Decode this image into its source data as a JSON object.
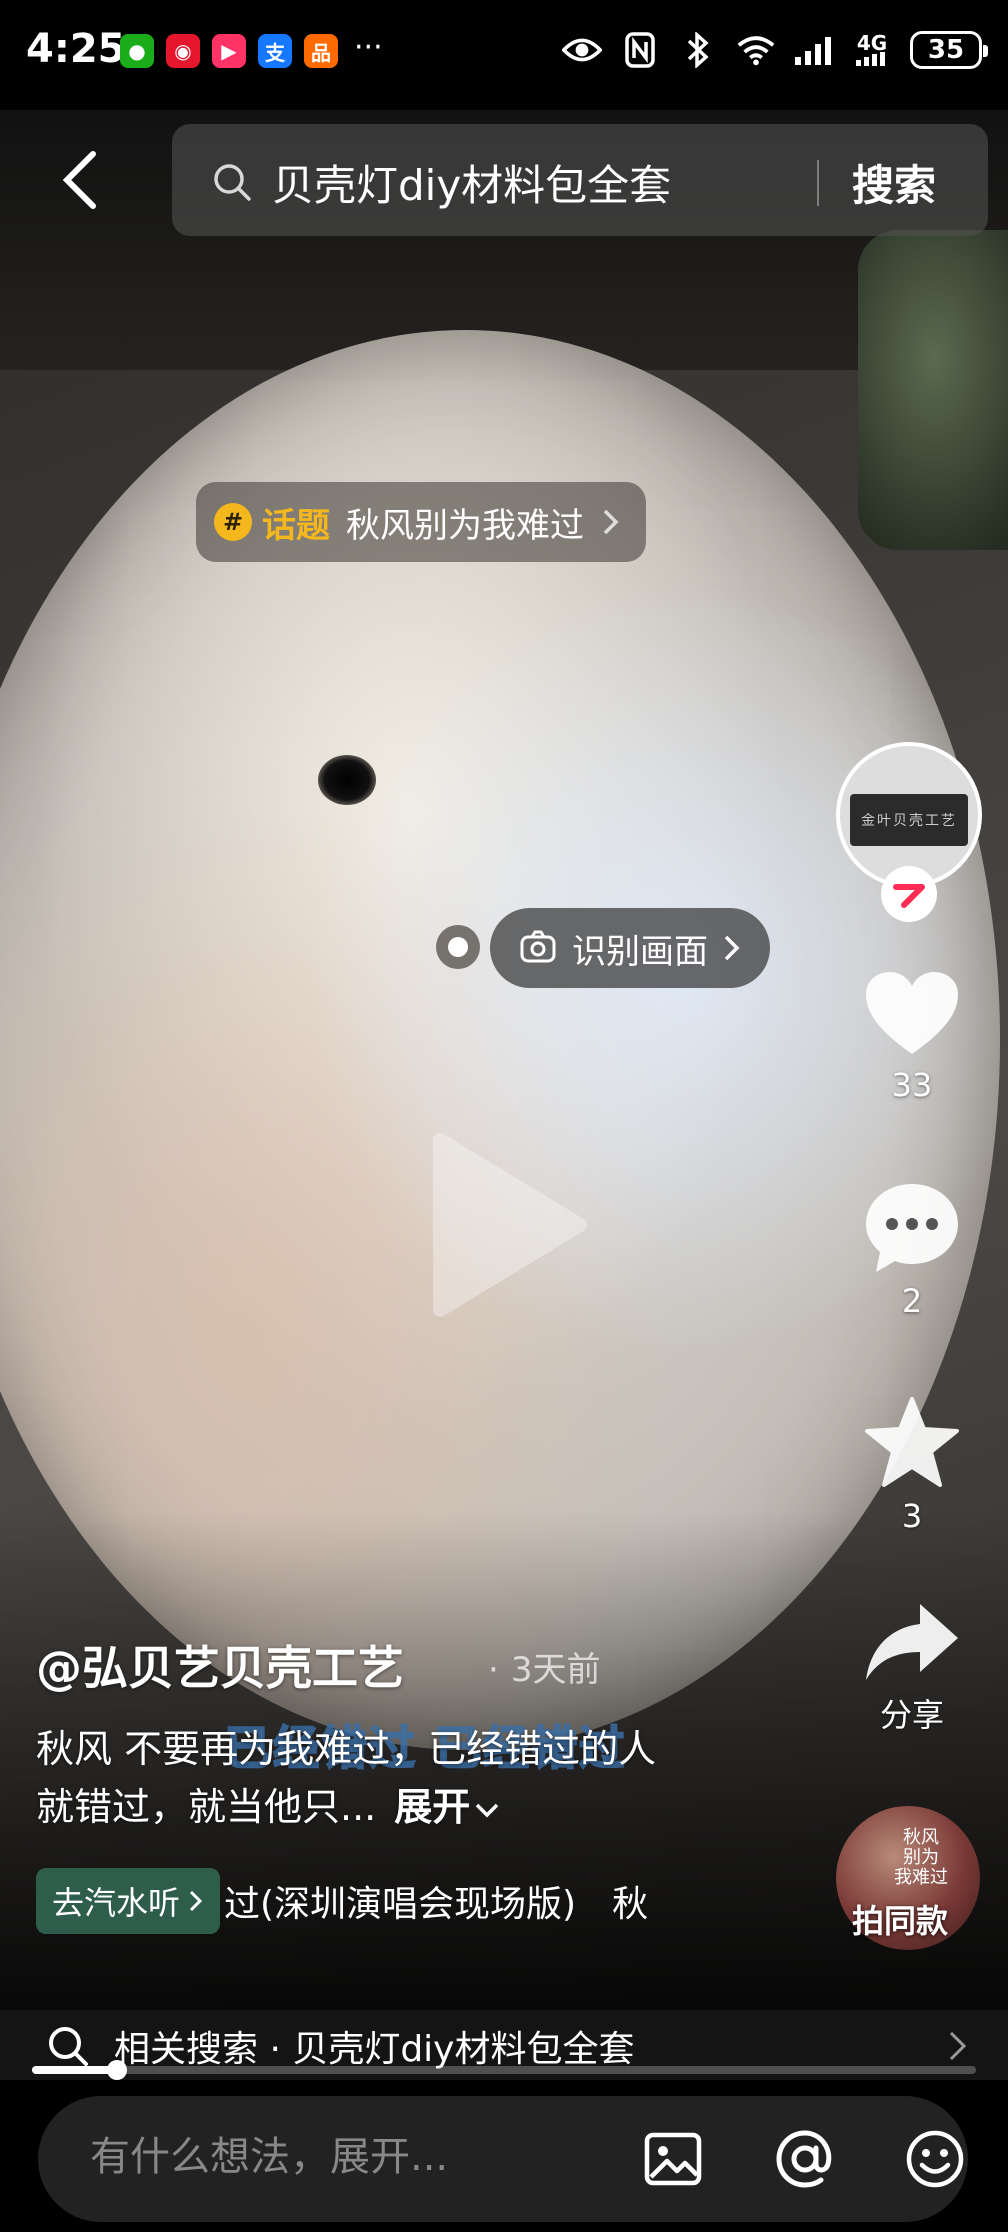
{
  "status_bar": {
    "time": "4:25",
    "network": "4G",
    "battery": "35",
    "more_indicator": "···"
  },
  "app_icons": [
    {
      "name": "wechat-icon",
      "color": "#1aad19",
      "glyph": "●"
    },
    {
      "name": "weibo-icon",
      "color": "#e6162d",
      "glyph": "◉"
    },
    {
      "name": "video-app-icon",
      "color": "#ff3366",
      "glyph": "▶"
    },
    {
      "name": "alipay-icon",
      "color": "#1677ff",
      "glyph": "支"
    },
    {
      "name": "shopping-app-icon",
      "color": "#ff6a00",
      "glyph": "品"
    }
  ],
  "search": {
    "query": "贝壳灯diy材料包全套",
    "button_label": "搜索"
  },
  "topic": {
    "label": "话题",
    "name": "秋风别为我难过"
  },
  "recognize": {
    "label": "识别画面"
  },
  "rail": {
    "likes": "33",
    "comments": "2",
    "favorites": "3",
    "share_label": "分享",
    "same_label": "拍同款",
    "avatar_text": "金叶贝壳工艺",
    "music_disc_text": "秋风\n别为\n我难过"
  },
  "post": {
    "author": "@弘贝艺贝壳工艺",
    "time_ago": "3天前",
    "description": "秋风 不要再为我难过，已经错过的人就错过，就当他只...",
    "expand_label": "展开",
    "subtitle_overlay": "已经错过 已经错过"
  },
  "music": {
    "chip_label": "去汽水听",
    "title": "过(深圳演唱会现场版)　秋"
  },
  "related": {
    "text": "相关搜索 · 贝壳灯diy材料包全套"
  },
  "progress": {
    "percent": 9
  },
  "comment": {
    "placeholder": "有什么想法，展开..."
  },
  "colors": {
    "topic_accent": "#f5b81c",
    "music_chip": "#2e5d4b",
    "follow_badge": "#fe2c55"
  }
}
